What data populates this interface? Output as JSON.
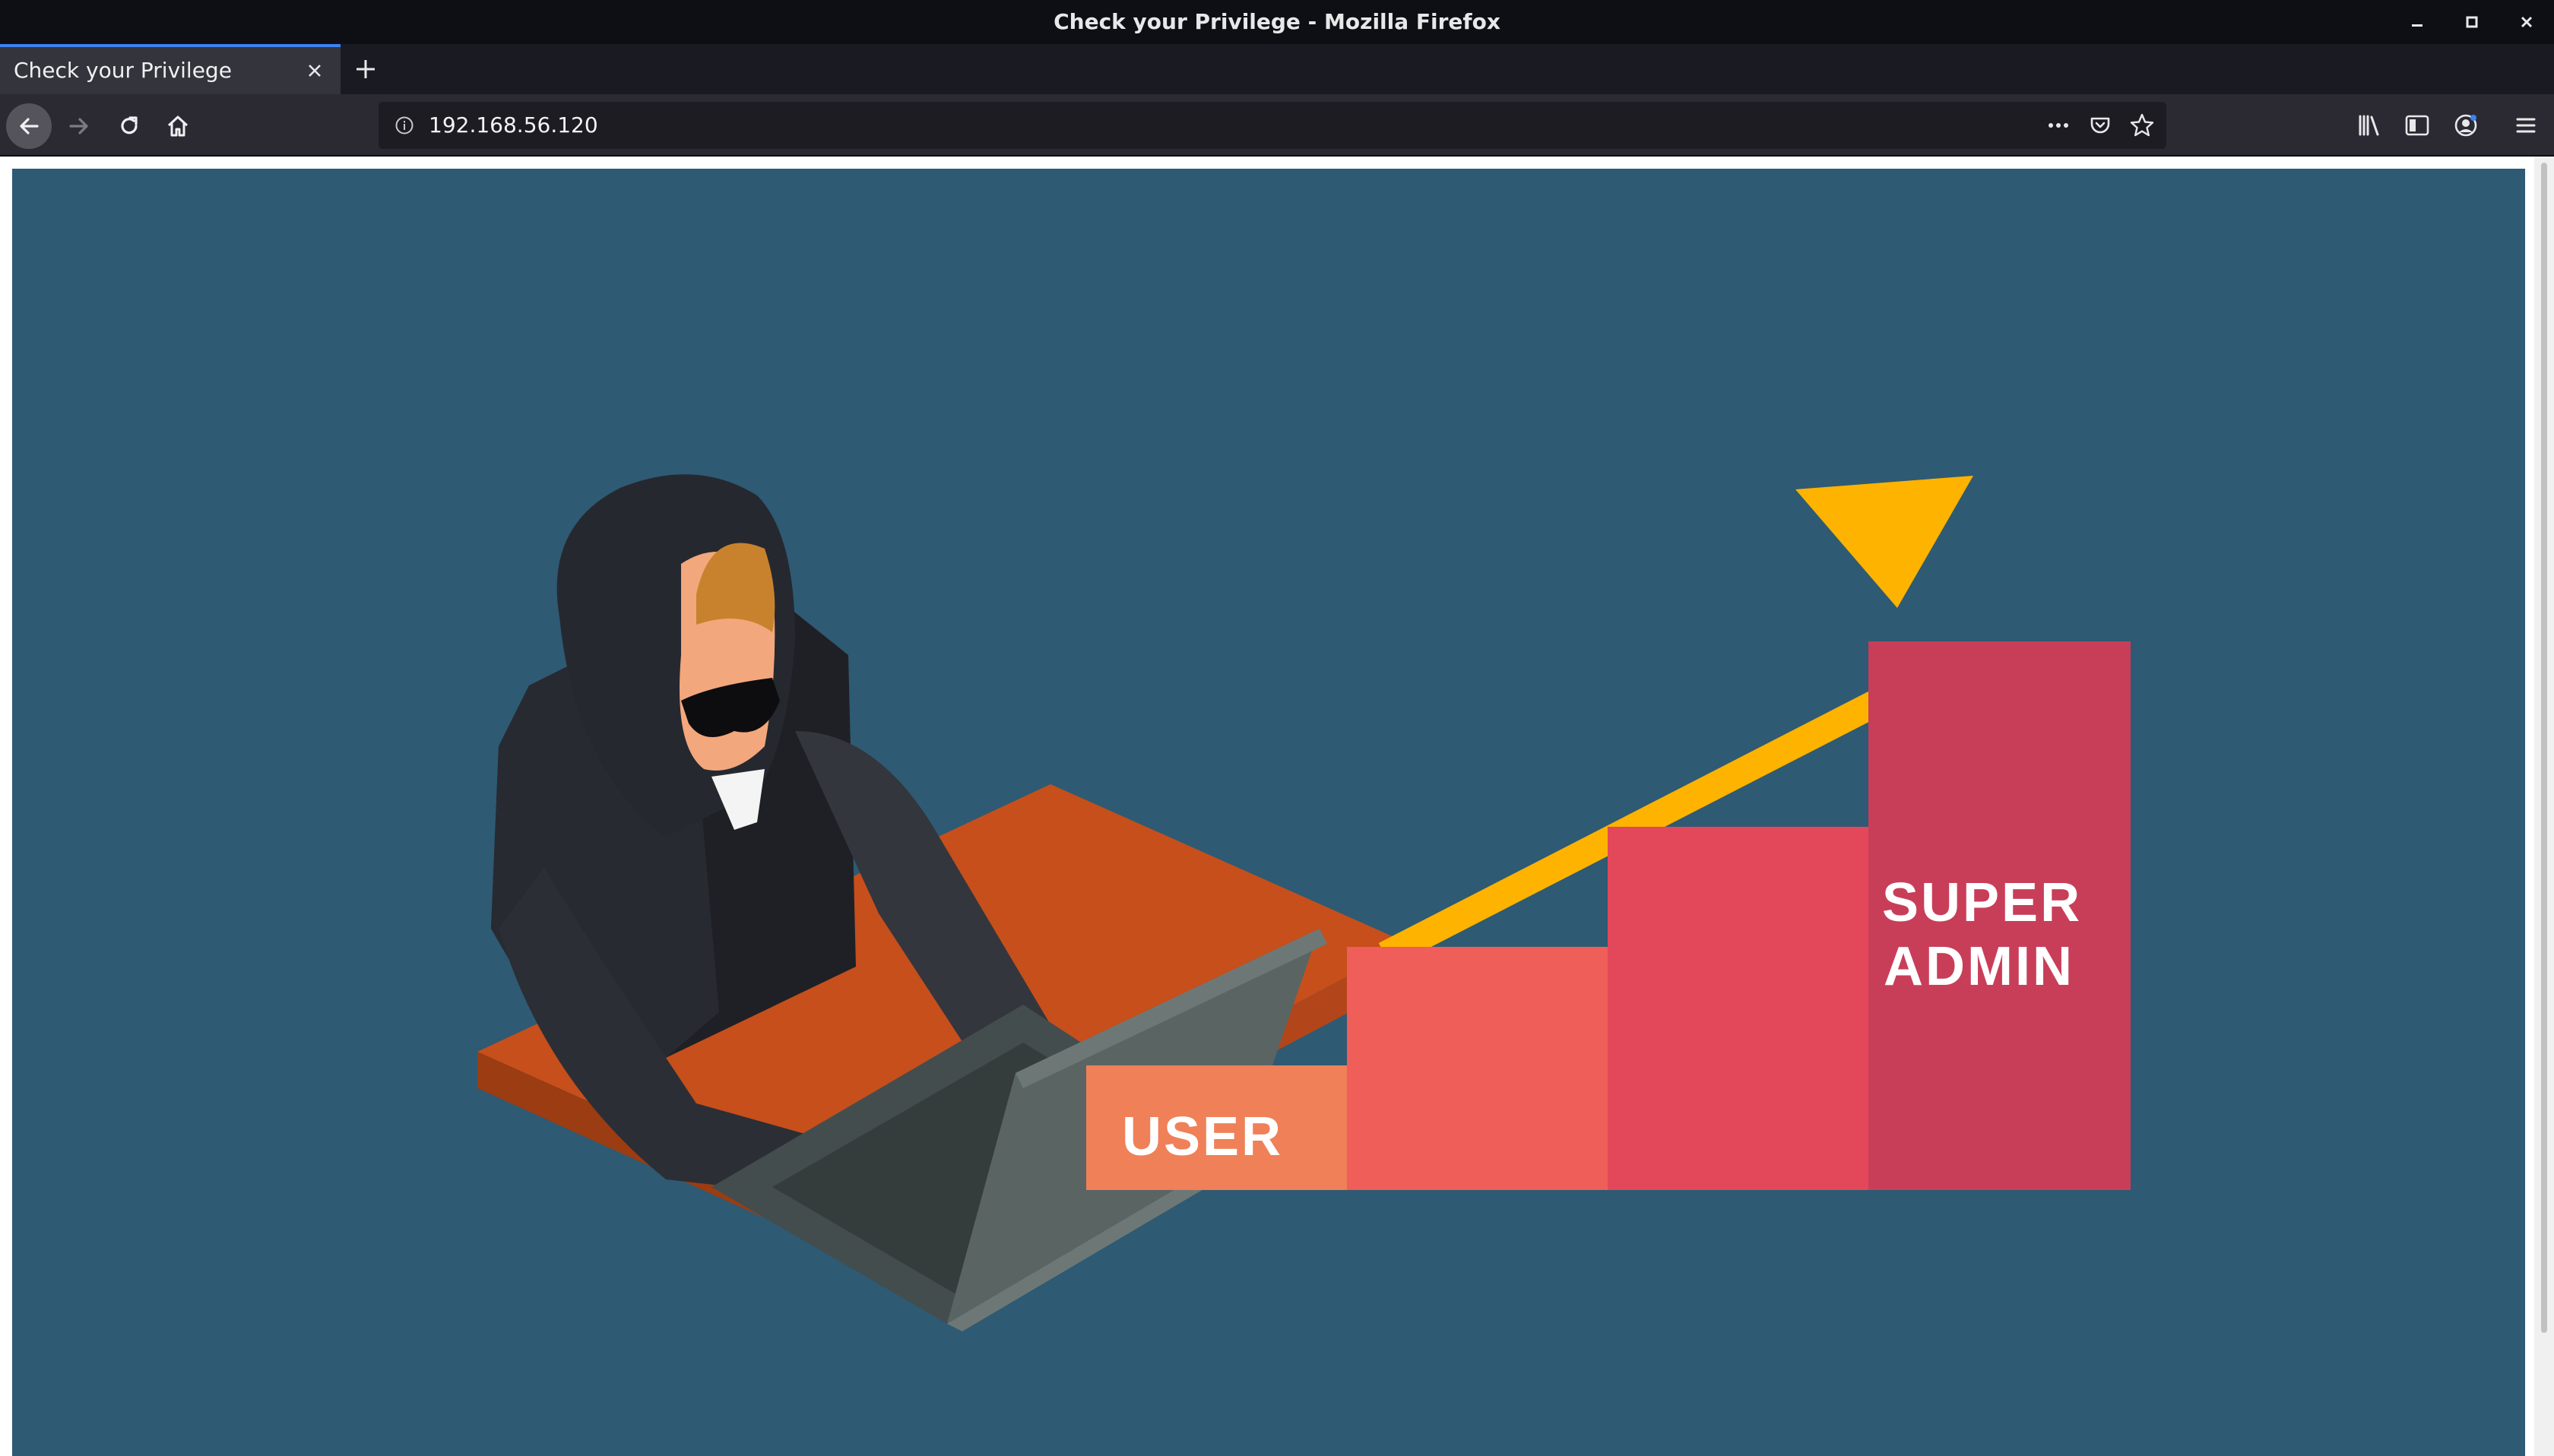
{
  "window": {
    "title": "Check your Privilege - Mozilla Firefox"
  },
  "tabs": [
    {
      "label": "Check your Privilege",
      "active": true
    }
  ],
  "navbar": {
    "url": "192.168.56.120"
  },
  "page": {
    "background_color": "#2e5a73",
    "illustration": {
      "step_labels": [
        "USER",
        "SUPER",
        "ADMIN"
      ],
      "step_colors": [
        "#f08058",
        "#ef5e58",
        "#e24859",
        "#c83e58"
      ],
      "arrow_color": "#fdb300"
    }
  },
  "icons": {
    "minimize": "minimize-icon",
    "maximize": "maximize-icon",
    "close": "close-icon",
    "tab_close": "close-icon",
    "new_tab": "plus-icon",
    "back": "back-arrow-icon",
    "forward": "forward-arrow-icon",
    "reload": "reload-icon",
    "home": "home-icon",
    "site_info": "info-icon",
    "page_actions": "ellipsis-icon",
    "pocket": "pocket-icon",
    "bookmark": "star-icon",
    "library": "library-icon",
    "sidebar": "sidebar-icon",
    "account": "account-icon",
    "menu": "hamburger-menu-icon"
  }
}
